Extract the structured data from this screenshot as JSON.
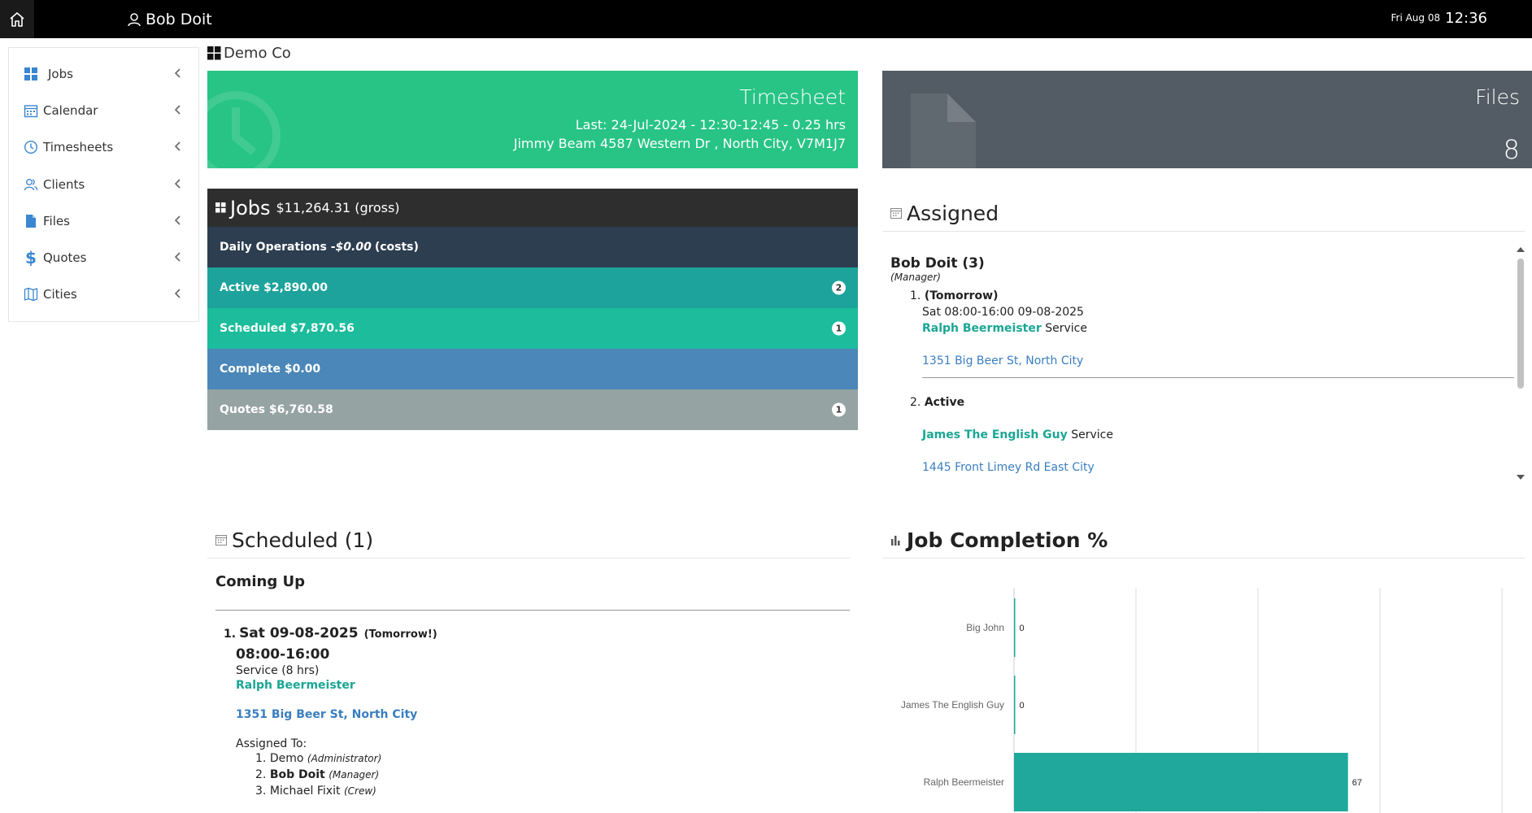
{
  "topbar": {
    "user_name": "Bob Doit",
    "date": "Fri Aug 08",
    "time": "12:36"
  },
  "sidebar": {
    "items": [
      {
        "label": "Jobs",
        "icon": "grid-icon"
      },
      {
        "label": "Calendar",
        "icon": "calendar-icon"
      },
      {
        "label": "Timesheets",
        "icon": "clock-icon"
      },
      {
        "label": "Clients",
        "icon": "users-icon"
      },
      {
        "label": "Files",
        "icon": "file-icon"
      },
      {
        "label": "Quotes",
        "icon": "dollar-icon"
      },
      {
        "label": "Cities",
        "icon": "map-icon"
      }
    ]
  },
  "breadcrumb": {
    "company": "Demo Co"
  },
  "timesheet": {
    "title": "Timesheet",
    "last": "Last: 24-Jul-2024 - 12:30-12:45 - 0.25 hrs",
    "location": "Jimmy Beam 4587 Western Dr , North City, V7M1J7"
  },
  "files": {
    "title": "Files",
    "count": "8"
  },
  "jobs": {
    "title": "Jobs",
    "gross": "$11,264.31 (gross)",
    "daily_prefix": "Daily Operations -",
    "daily_amount": "$0.00",
    "daily_suffix": "(costs)",
    "rows": [
      {
        "label": "Active $2,890.00",
        "badge": "2",
        "color": "#1da39b"
      },
      {
        "label": "Scheduled $7,870.56",
        "badge": "1",
        "color": "#1cbc9c"
      },
      {
        "label": "Complete $0.00",
        "badge": "",
        "color": "#4b87b9"
      },
      {
        "label": "Quotes $6,760.58",
        "badge": "1",
        "color": "#95a3a2"
      }
    ],
    "colors": {
      "header": "#2e2e2e",
      "daily": "#2c3e50"
    }
  },
  "assigned": {
    "title": "Assigned",
    "person": "Bob Doit (3)",
    "role": "Manager",
    "items": [
      {
        "num": "1.",
        "status": "(Tomorrow)",
        "when": "Sat 08:00-16:00 09-08-2025",
        "client": "Ralph Beermeister",
        "service": "Service",
        "address": "1351 Big Beer St, North City"
      },
      {
        "num": "2.",
        "status": "Active",
        "when": "",
        "client": "James The English Guy",
        "service": "Service",
        "address": "1445 Front Limey Rd East City"
      }
    ]
  },
  "scheduled": {
    "title": "Scheduled (1)",
    "subtitle": "Coming Up",
    "items": [
      {
        "num": "1.",
        "date": "Sat 09-08-2025",
        "tag": "(Tomorrow!)",
        "time": "08:00-16:00",
        "service": "Service (8 hrs)",
        "client": "Ralph Beermeister",
        "address": "1351 Big Beer St, North City",
        "assigned_label": "Assigned To:",
        "assigned": [
          {
            "num": "1.",
            "name": "Demo",
            "role": "Administrator",
            "bold": false
          },
          {
            "num": "2.",
            "name": "Bob Doit",
            "role": "Manager",
            "bold": true
          },
          {
            "num": "3.",
            "name": "Michael Fixit",
            "role": "Crew",
            "bold": false
          }
        ]
      }
    ]
  },
  "completion": {
    "title": "Job Completion %"
  },
  "chart_data": {
    "type": "bar",
    "orientation": "horizontal",
    "title": "Job Completion %",
    "categories": [
      "Big John",
      "James The English Guy",
      "Ralph Beermeister"
    ],
    "values": [
      0,
      0,
      67
    ],
    "xlim": [
      0,
      100
    ],
    "grid": true,
    "color": "#1fa89b"
  }
}
